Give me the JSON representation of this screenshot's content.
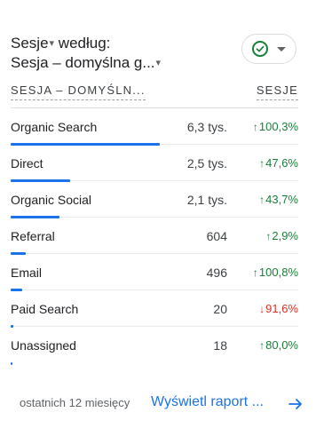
{
  "card": {
    "title_line1": "Sesje",
    "title_line1_suffix": " według:",
    "title_line2": "Sesja – domyślna g...",
    "caret_glyph": "▾"
  },
  "columns": {
    "dimension": "SESJA – DOMYŚLN...",
    "metric": "SESJE"
  },
  "rows": [
    {
      "name": "Organic Search",
      "value": "6,3 tys.",
      "change": "100,3%",
      "direction": "up",
      "share": 1.0
    },
    {
      "name": "Direct",
      "value": "2,5 tys.",
      "change": "47,6%",
      "direction": "up",
      "share": 0.4
    },
    {
      "name": "Organic Social",
      "value": "2,1 tys.",
      "change": "43,7%",
      "direction": "up",
      "share": 0.33
    },
    {
      "name": "Referral",
      "value": "604",
      "change": "2,9%",
      "direction": "up",
      "share": 0.1
    },
    {
      "name": "Email",
      "value": "496",
      "change": "100,8%",
      "direction": "up",
      "share": 0.08
    },
    {
      "name": "Paid Search",
      "value": "20",
      "change": "91,6%",
      "direction": "down",
      "share": 0.02
    },
    {
      "name": "Unassigned",
      "value": "18",
      "change": "80,0%",
      "direction": "up",
      "share": 0.01
    }
  ],
  "footer": {
    "period": "ostatnich 12 miesięcy",
    "link": "Wyświetl raport ..."
  },
  "icons": {
    "filter_status": "check-circle-icon",
    "dropdown": "chevron-down-icon",
    "navigate": "arrow-right-icon"
  },
  "colors": {
    "accent": "#1a73e8",
    "positive": "#188038",
    "negative": "#d93025"
  }
}
